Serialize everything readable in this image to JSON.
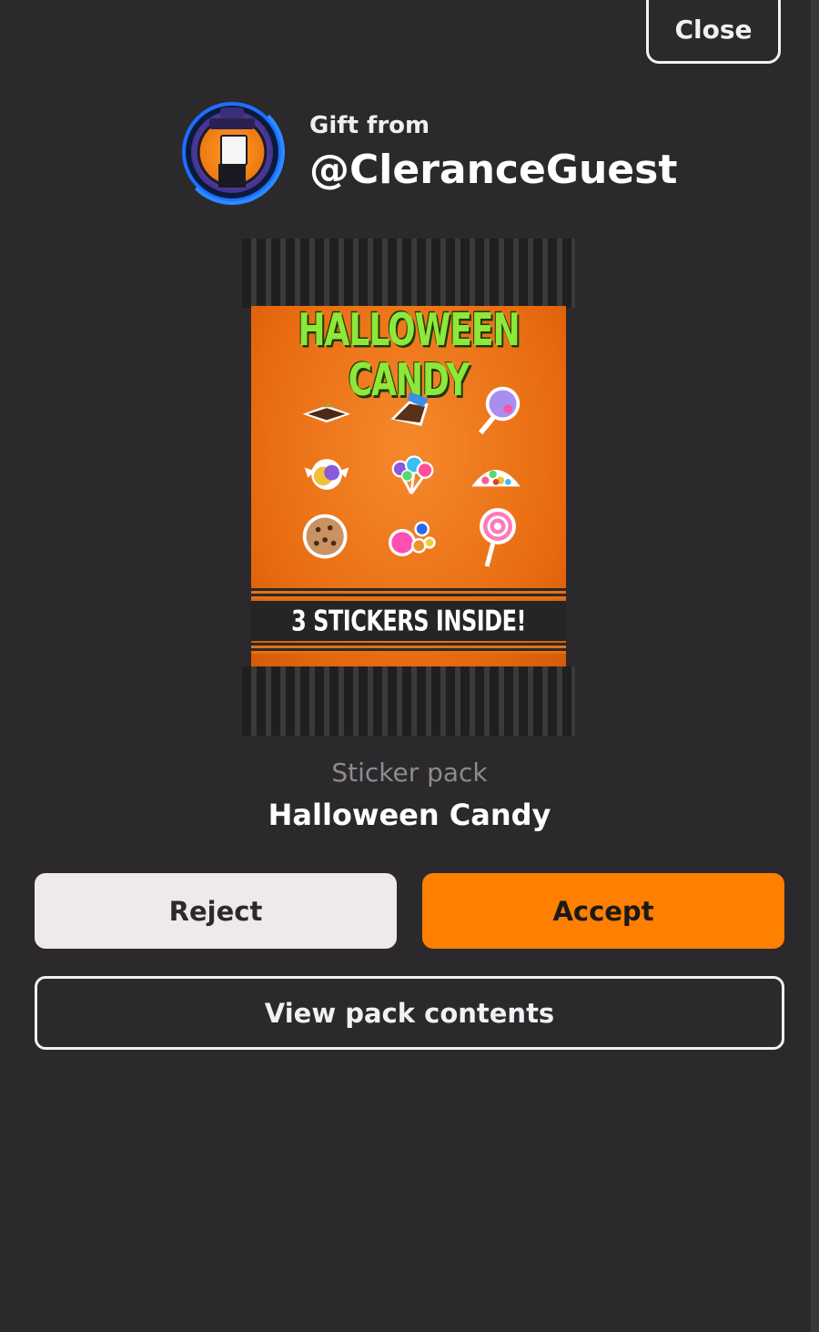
{
  "header": {
    "close_label": "Close"
  },
  "sender": {
    "gift_from_label": "Gift from",
    "username": "@CleranceGuest",
    "avatar_icon": "avatar-witch-hat"
  },
  "pack": {
    "art_title": "HALLOWEEN CANDY",
    "art_band": "3 STICKERS INSIDE!",
    "type_label": "Sticker pack",
    "name": "Halloween Candy",
    "candy_icons": [
      "chocolate-bar-icon",
      "chocolate-chunk-icon",
      "lollipop-icon",
      "wrapped-candy-icon",
      "lollipop-bunch-icon",
      "gummy-pile-icon",
      "cookie-icon",
      "gumballs-icon",
      "swirl-lollipop-icon"
    ]
  },
  "actions": {
    "reject_label": "Reject",
    "accept_label": "Accept",
    "view_contents_label": "View pack contents"
  },
  "colors": {
    "background": "#2c292d",
    "accent": "#ff7f00",
    "reject_bg": "#ede9ed",
    "muted_text": "#8e8b8f"
  }
}
